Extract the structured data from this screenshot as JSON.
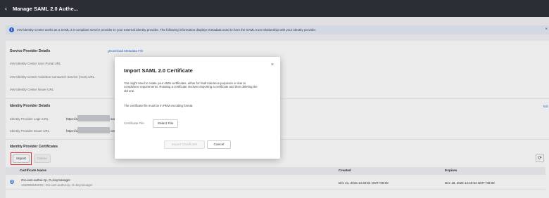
{
  "header": {
    "back_icon": "chevron-left-icon",
    "title": "Manage SAML 2.0 Authe..."
  },
  "info_bar": {
    "text": "IAM Identity Center works as a SAML 2.0 compliant service provider to your external identity provider. The following information displays metadata used to form the SAML trust relationship with your identity provider.",
    "close": "×"
  },
  "service_provider": {
    "title": "Service Provider Details",
    "download_link": "Download Metadata File",
    "rows": [
      "IAM Identity Center User Portal URL",
      "IAM Identity Center Assertion Consumer Service (ACS) URL",
      "IAM Identity Center Issuer URL"
    ]
  },
  "identity_provider": {
    "title": "Identity Provider Details",
    "edit": "Edi",
    "login_label": "Identity Provider Login URL",
    "login_value_prefix": "https://ac",
    "login_value_suffix": "saml-",
    "issuer_label": "Identity Provider Issuer URL",
    "issuer_value_prefix": "https://ac",
    "issuer_value_suffix": "om/-"
  },
  "certificates": {
    "title": "Identity Provider Certificates",
    "import_label": "Import",
    "delete_label": "Delete",
    "refresh_icon": "refresh-icon",
    "columns": [
      "Certificate Name",
      "Created",
      "Expires"
    ],
    "rows": [
      {
        "name": "OU=iam-authui-zp, O=keymanager",
        "subname": "1450685545039 | OU=iam-authui-zp, O=keymanager",
        "created": "Dec 21, 2015 14:40:54 GMT+08:00",
        "expires": "Dec 18, 2025 14:40:54 GMT+08:00",
        "selected": true
      }
    ]
  },
  "dialog": {
    "title": "Import SAML 2.0 Certificate",
    "close": "×",
    "description": "You might need to rotate your x509 certificates, either for fault tolerance purposes or due to compliance requirements. Rotating a certificate involves importing a certificate and then deleting the old one.",
    "note": "The certificate file must be in PEM encoding format.",
    "file_label": "Certificate File",
    "select_file": "Select File",
    "import_button": "Import Certificate",
    "cancel_button": "Cancel"
  },
  "colors": {
    "accent": "#2f6dd8",
    "header_bg": "#2b2e35",
    "highlight": "#e0353b"
  }
}
